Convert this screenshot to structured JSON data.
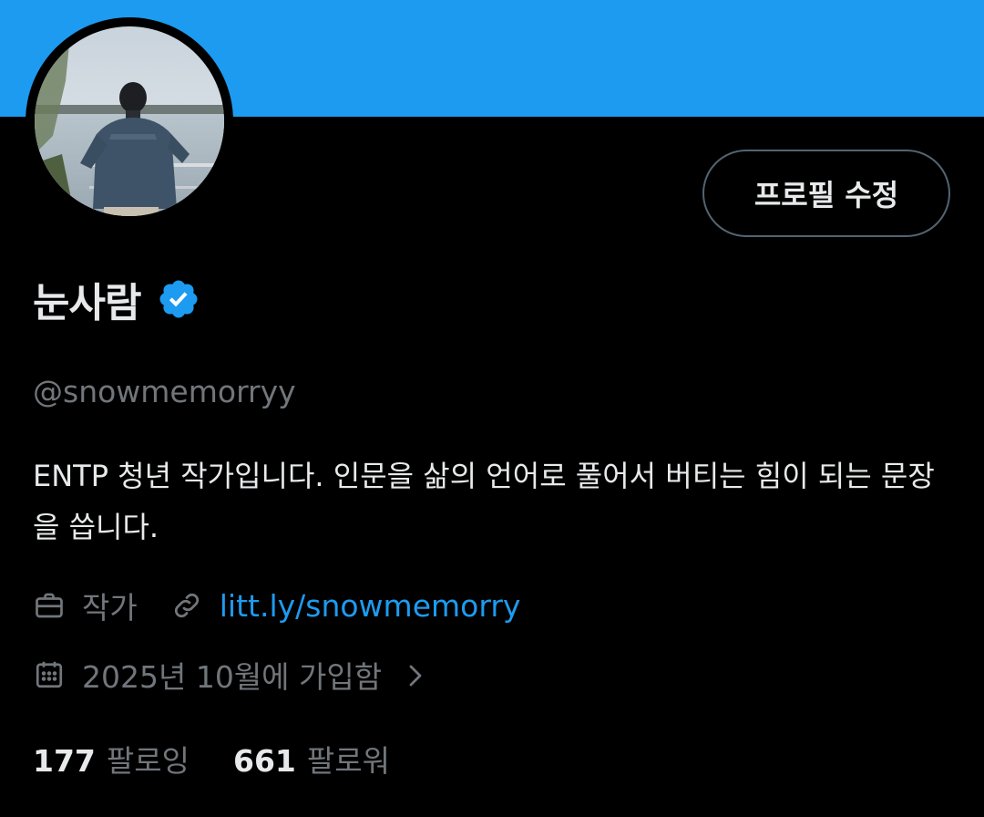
{
  "profile": {
    "display_name": "눈사람",
    "handle": "@snowmemorryy",
    "bio": "ENTP 청년 작가입니다. 인문을 삶의 언어로 풀어서 버티는 힘이 되는 문장을 씁니다.",
    "verified": true,
    "edit_button_label": "프로필 수정",
    "occupation": "작가",
    "website": "litt.ly/snowmemorry",
    "joined": "2025년 10월에 가입함",
    "following_count": "177",
    "following_label": "팔로잉",
    "followers_count": "661",
    "followers_label": "팔로워"
  },
  "icons": {
    "occupation": "briefcase-icon",
    "website": "link-icon",
    "joined": "calendar-icon",
    "joined_more": "chevron-right-icon",
    "verified": "verified-badge-icon"
  },
  "colors": {
    "banner": "#1d9bf0",
    "background": "#000000",
    "primary_text": "#e7e9ea",
    "secondary_text": "#71767b",
    "link": "#1d9bf0",
    "button_border": "#536471"
  }
}
